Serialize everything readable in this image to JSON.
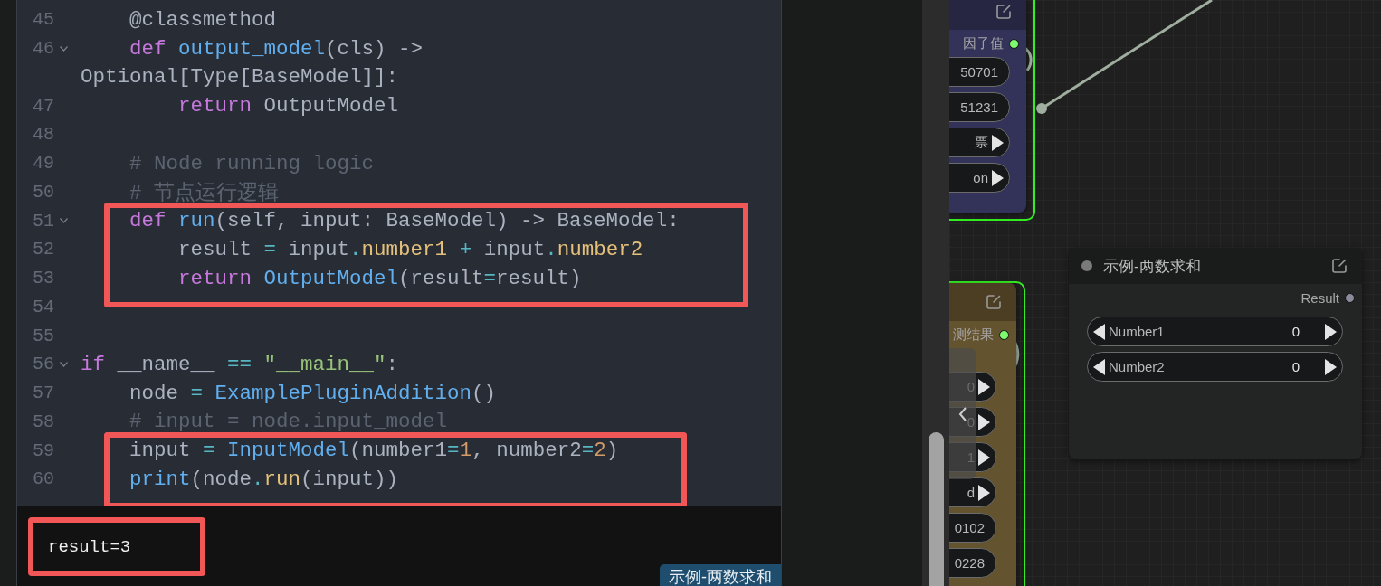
{
  "editor": {
    "lines": [
      {
        "number": "45",
        "fold": false,
        "highlighted": false,
        "tokens": [
          {
            "kind": "plain",
            "text": "    @classmethod"
          }
        ]
      },
      {
        "number": "46",
        "fold": true,
        "highlighted": false,
        "tokens": [
          {
            "kind": "keyword",
            "text": "    def "
          },
          {
            "kind": "function",
            "text": "output_model"
          },
          {
            "kind": "plain",
            "text": "(cls) ->"
          }
        ]
      },
      {
        "fold": false,
        "highlighted": false,
        "tokens": [
          {
            "kind": "plain",
            "text": "Optional[Type[BaseModel]]:"
          }
        ]
      },
      {
        "number": "47",
        "fold": false,
        "highlighted": false,
        "tokens": [
          {
            "kind": "keyword",
            "text": "        return"
          },
          {
            "kind": "plain",
            "text": " OutputModel"
          }
        ]
      },
      {
        "number": "48",
        "fold": false,
        "highlighted": false
      },
      {
        "number": "49",
        "fold": false,
        "highlighted": false,
        "tokens": [
          {
            "kind": "comment",
            "text": "    # Node running logic"
          }
        ]
      },
      {
        "number": "50",
        "fold": false,
        "highlighted": false,
        "tokens": [
          {
            "kind": "comment",
            "text": "    # 节点运行逻辑"
          }
        ]
      },
      {
        "number": "51",
        "fold": true,
        "highlighted": true,
        "tokens": [
          {
            "kind": "keyword",
            "text": "    def "
          },
          {
            "kind": "function",
            "text": "run"
          },
          {
            "kind": "plain",
            "text": "(self, input: BaseModel) -> BaseModel:"
          }
        ]
      },
      {
        "number": "52",
        "fold": false,
        "highlighted": true,
        "tokens": [
          {
            "kind": "plain",
            "text": "        result "
          },
          {
            "kind": "operator",
            "text": "="
          },
          {
            "kind": "plain",
            "text": " input"
          },
          {
            "kind": "operator",
            "text": "."
          },
          {
            "kind": "attribute",
            "text": "number1 "
          },
          {
            "kind": "operator",
            "text": "+"
          },
          {
            "kind": "plain",
            "text": " input"
          },
          {
            "kind": "operator",
            "text": "."
          },
          {
            "kind": "attribute",
            "text": "number2"
          }
        ]
      },
      {
        "number": "53",
        "fold": false,
        "highlighted": true,
        "tokens": [
          {
            "kind": "keyword",
            "text": "        return "
          },
          {
            "kind": "function",
            "text": "OutputModel"
          },
          {
            "kind": "plain",
            "text": "(result"
          },
          {
            "kind": "operator",
            "text": "="
          },
          {
            "kind": "plain",
            "text": "result)"
          }
        ]
      },
      {
        "number": "54",
        "fold": false,
        "highlighted": false
      },
      {
        "number": "55",
        "fold": false,
        "highlighted": false
      },
      {
        "number": "56",
        "fold": true,
        "highlighted": false,
        "tokens": [
          {
            "kind": "keyword",
            "text": "if"
          },
          {
            "kind": "plain",
            "text": " __name__ "
          },
          {
            "kind": "operator",
            "text": "=="
          },
          {
            "kind": "string",
            "text": " \"__main__\""
          },
          {
            "kind": "plain",
            "text": ":"
          }
        ]
      },
      {
        "number": "57",
        "fold": false,
        "highlighted": false,
        "tokens": [
          {
            "kind": "plain",
            "text": "    node "
          },
          {
            "kind": "operator",
            "text": "="
          },
          {
            "kind": "function",
            "text": " ExamplePluginAddition"
          },
          {
            "kind": "plain",
            "text": "()"
          }
        ]
      },
      {
        "number": "58",
        "fold": false,
        "highlighted": false,
        "tokens": [
          {
            "kind": "comment",
            "text": "    # input = node.input_model"
          }
        ]
      },
      {
        "number": "59",
        "fold": false,
        "highlighted": true,
        "tokens": [
          {
            "kind": "plain",
            "text": "    input "
          },
          {
            "kind": "operator",
            "text": "="
          },
          {
            "kind": "function",
            "text": " InputModel"
          },
          {
            "kind": "plain",
            "text": "(number1"
          },
          {
            "kind": "operator",
            "text": "="
          },
          {
            "kind": "number",
            "text": "1"
          },
          {
            "kind": "plain",
            "text": ", number2"
          },
          {
            "kind": "operator",
            "text": "="
          },
          {
            "kind": "number",
            "text": "2"
          },
          {
            "kind": "plain",
            "text": ")"
          }
        ]
      },
      {
        "number": "60",
        "fold": false,
        "highlighted": true,
        "tokens": [
          {
            "kind": "function",
            "text": "    print"
          },
          {
            "kind": "plain",
            "text": "(node"
          },
          {
            "kind": "operator",
            "text": "."
          },
          {
            "kind": "attribute",
            "text": "run"
          },
          {
            "kind": "plain",
            "text": "(input))"
          }
        ]
      }
    ]
  },
  "output": {
    "text": "result=3",
    "highlighted": true
  },
  "node_tag": "示例-两数求和",
  "canvas": {
    "nodes": [
      {
        "selected": true,
        "color": "#33335a",
        "outputs": [
          {
            "label": "因子值",
            "connected": true
          }
        ],
        "widgets": [
          {
            "label": "50701",
            "arrows": false
          },
          {
            "label": "51231",
            "arrows": false
          },
          {
            "label": "票",
            "arrows": true
          },
          {
            "label": "on",
            "arrows": true
          }
        ]
      },
      {
        "selected": true,
        "color": "#64532f",
        "outputs": [
          {
            "label": "测结果",
            "connected": true
          }
        ],
        "widgets": [
          {
            "label": "0",
            "arrows": true
          },
          {
            "label": "0",
            "arrows": true
          },
          {
            "label": "1",
            "arrows": true
          },
          {
            "label": "d",
            "arrows": true
          },
          {
            "label": "0102",
            "arrows": false
          },
          {
            "label": "0228",
            "arrows": false
          }
        ]
      },
      {
        "selected": false,
        "color": "#232424",
        "title": "示例-两数求和",
        "outputs": [
          {
            "label": "Result",
            "connected": false
          }
        ],
        "widgets": [
          {
            "label": "Number1",
            "value": "0",
            "arrows": true
          },
          {
            "label": "Number2",
            "value": "0",
            "arrows": true
          }
        ]
      }
    ]
  }
}
